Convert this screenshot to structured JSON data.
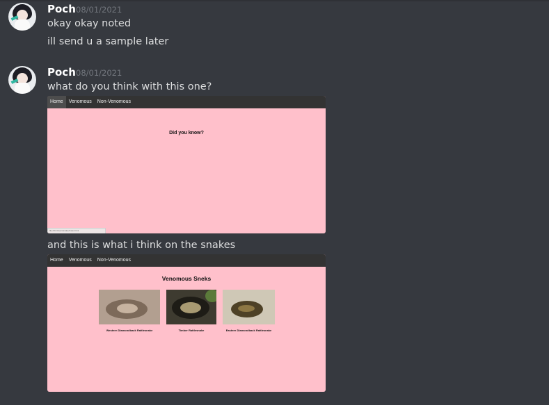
{
  "messages": [
    {
      "username": "Poch",
      "timestamp": "08/01/2021",
      "lines": [
        "okay okay noted",
        "ill send u a sample later"
      ]
    },
    {
      "username": "Poch",
      "timestamp": "08/01/2021",
      "lines": [
        "what do you think with this one?",
        "and this is what i think on the snakes"
      ]
    }
  ],
  "attachments": [
    {
      "nav": [
        "Home",
        "Venomous",
        "Non-Venomous"
      ],
      "active_tab": "Home",
      "heading": "Did you know?",
      "status_text": "file:///C:/Users/snake/index.html"
    },
    {
      "nav": [
        "Home",
        "Venomous",
        "Non-Venomous"
      ],
      "heading": "Venomous Sneks",
      "snakes": [
        {
          "name": "Western Diamondback Rattlesnake"
        },
        {
          "name": "Timber Rattlesnake"
        },
        {
          "name": "Eastern Diamondback Rattlesnake"
        }
      ]
    }
  ],
  "colors": {
    "background": "#36393f",
    "page_pink": "#ffc0cb",
    "navbar": "#333333",
    "username": "#ffffff",
    "timestamp": "#72767d"
  }
}
